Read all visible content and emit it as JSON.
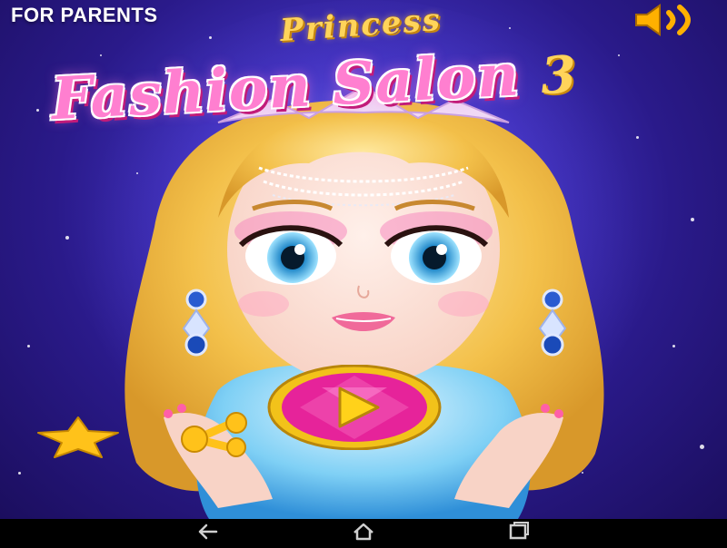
{
  "header": {
    "for_parents_label": "FOR PARENTS"
  },
  "title": {
    "line1": "Princess",
    "line2": "Fashion Salon",
    "number": "3"
  },
  "icons": {
    "sound": "speaker-volume-icon",
    "play": "play-icon",
    "star": "star-icon",
    "share": "share-icon",
    "nav_back": "back-arrow-icon",
    "nav_home": "home-icon",
    "nav_recents": "recents-icon"
  },
  "colors": {
    "background": "#3d2fb8",
    "play_ring": "#f2c21a",
    "play_gem": "#e6239a",
    "star": "#ffc21a",
    "title_pink": "#ff7fd0",
    "title_gold": "#ffd45a"
  }
}
